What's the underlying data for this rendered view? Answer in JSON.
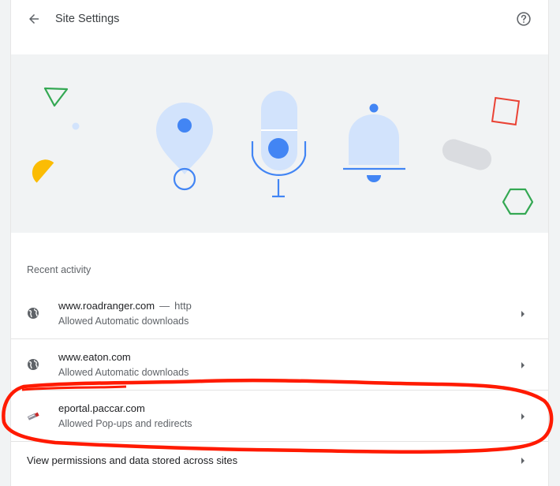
{
  "header": {
    "title": "Site Settings"
  },
  "recent_activity": {
    "label": "Recent activity",
    "items": [
      {
        "site": "www.roadranger.com",
        "separator": "—",
        "protocol": "http",
        "detail": "Allowed Automatic downloads",
        "icon": "globe-icon"
      },
      {
        "site": "www.eaton.com",
        "detail": "Allowed Automatic downloads",
        "icon": "globe-icon"
      },
      {
        "site": "eportal.paccar.com",
        "detail": "Allowed Pop-ups and redirects",
        "icon": "truck-favicon-icon"
      }
    ]
  },
  "permissions_link": {
    "label": "View permissions and data stored across sites"
  },
  "colors": {
    "annotation": "#ff1a00",
    "accent_blue": "#4285f4",
    "light_blue": "#d2e3fc",
    "banner_bg": "#f1f3f4"
  }
}
